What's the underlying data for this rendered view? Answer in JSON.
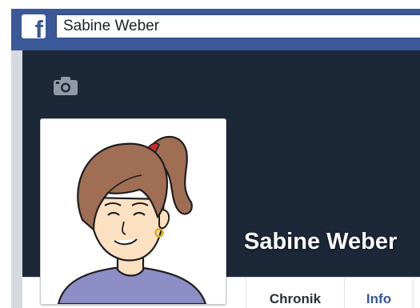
{
  "header": {
    "logo_letter": "f",
    "search_value": "Sabine Weber"
  },
  "profile": {
    "name": "Sabine Weber",
    "camera_icon": "camera-icon"
  },
  "tabs": [
    {
      "label": "Chronik"
    },
    {
      "label": "Info"
    }
  ],
  "colors": {
    "brand": "#3b5998",
    "cover": "#1c2838",
    "tab_active": "#365899"
  }
}
